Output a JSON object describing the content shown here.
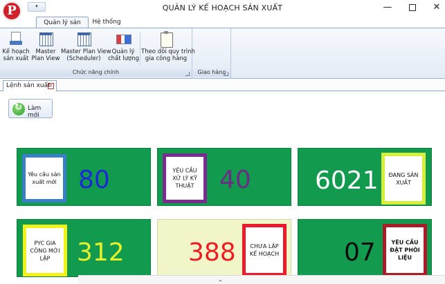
{
  "window": {
    "title": "QUẢN LÝ KẾ HOẠCH SẢN XUẤT",
    "min": "—",
    "close": "✕",
    "qat": "▾"
  },
  "app_logo": "P",
  "ribbon": {
    "tabs": [
      "Quản lý sản xuất",
      "Hệ thống"
    ],
    "groups": [
      {
        "label": "Chức năng chính",
        "buttons": [
          {
            "line1": "Kế hoạch",
            "line2": "sản xuất"
          },
          {
            "line1": "Master",
            "line2": "Plan View"
          },
          {
            "line1": "Master Plan View",
            "line2": "(Scheduler)"
          },
          {
            "line1": "Quản lý",
            "line2": "chất lượng"
          },
          {
            "line1": "Theo dõi quy trình",
            "line2": "gia công hàng"
          }
        ]
      },
      {
        "label": "Giao hàng",
        "buttons": []
      }
    ]
  },
  "document_tab": {
    "label": "Lệnh sản xuất",
    "close": "✕"
  },
  "refresh_button": {
    "label": "Làm mới"
  },
  "tiles": [
    {
      "label": "Yêu cầu sản xuất mới",
      "value": "80",
      "frame_color": "#3a7fc7",
      "value_color": "#1c29d6"
    },
    {
      "label": "YÊU CẦU XỬ LÝ KỸ THUẬT",
      "value": "40",
      "frame_color": "#7b2d8f",
      "value_color": "#6b2d82"
    },
    {
      "label": "ĐANG SẢN XUẤT",
      "value": "6021",
      "frame_color": "#d7ef3a",
      "value_color": "#ffffff"
    },
    {
      "label": "PYC GIA CÔNG MỚI LẬP",
      "value": "312",
      "frame_color": "#f2f21a",
      "value_color": "#e8f22a"
    },
    {
      "label": "CHƯA LẬP KẾ HOẠCH",
      "value": "388",
      "frame_color": "#ea1b2a",
      "value_color": "#ee1b24"
    },
    {
      "label": "YÊU CẦU ĐẶT PHÔI LIỆU",
      "value": "07",
      "frame_color": "#a81d27",
      "value_color": "#0c0c0c"
    }
  ],
  "bottom_mark": "^"
}
